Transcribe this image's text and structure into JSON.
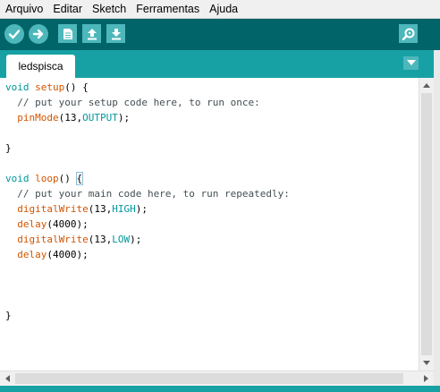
{
  "menu": {
    "items": [
      "Arquivo",
      "Editar",
      "Sketch",
      "Ferramentas",
      "Ajuda"
    ]
  },
  "toolbar": {
    "buttons": [
      "check-icon",
      "arrow-right-icon",
      "new-file-icon",
      "open-upload-icon",
      "save-download-icon"
    ],
    "serial_monitor_icon": "magnifier-icon"
  },
  "tabs": {
    "active": "ledspisca",
    "menu_icon": "chevron-down-icon"
  },
  "editor": {
    "lines": [
      [
        [
          "void",
          "kw-type"
        ],
        [
          " ",
          ""
        ],
        [
          "setup",
          "kw-fn"
        ],
        [
          "() {",
          ""
        ]
      ],
      [
        [
          "  // put your setup code here, to run once:",
          "cmt"
        ]
      ],
      [
        [
          "  ",
          ""
        ],
        [
          "pinMode",
          "kw-fn"
        ],
        [
          "(13,",
          ""
        ],
        [
          "OUTPUT",
          "kw-const"
        ],
        [
          ");",
          ""
        ]
      ],
      [
        [
          "",
          ""
        ]
      ],
      [
        [
          "}",
          ""
        ]
      ],
      [
        [
          "",
          ""
        ]
      ],
      [
        [
          "void",
          "kw-type"
        ],
        [
          " ",
          ""
        ],
        [
          "loop",
          "kw-fn"
        ],
        [
          "() ",
          ""
        ],
        [
          "{",
          "cursor-brace"
        ]
      ],
      [
        [
          "  // put your main code here, to run repeatedly:",
          "cmt"
        ]
      ],
      [
        [
          "  ",
          ""
        ],
        [
          "digitalWrite",
          "kw-fn"
        ],
        [
          "(13,",
          ""
        ],
        [
          "HIGH",
          "kw-const"
        ],
        [
          ");",
          ""
        ]
      ],
      [
        [
          "  ",
          ""
        ],
        [
          "delay",
          "kw-fn"
        ],
        [
          "(4000);",
          ""
        ]
      ],
      [
        [
          "  ",
          ""
        ],
        [
          "digitalWrite",
          "kw-fn"
        ],
        [
          "(13,",
          ""
        ],
        [
          "LOW",
          "kw-const"
        ],
        [
          ");",
          ""
        ]
      ],
      [
        [
          "  ",
          ""
        ],
        [
          "delay",
          "kw-fn"
        ],
        [
          "(4000);",
          ""
        ]
      ],
      [
        [
          "",
          ""
        ]
      ],
      [
        [
          "",
          ""
        ]
      ],
      [
        [
          "",
          ""
        ]
      ],
      [
        [
          "}",
          ""
        ]
      ]
    ]
  },
  "colors": {
    "toolbar": "#006468",
    "tabbar": "#17a1a5",
    "button": "#4db7bb",
    "keyword_type": "#00979c",
    "keyword_function": "#d35400",
    "comment": "#434f54"
  }
}
